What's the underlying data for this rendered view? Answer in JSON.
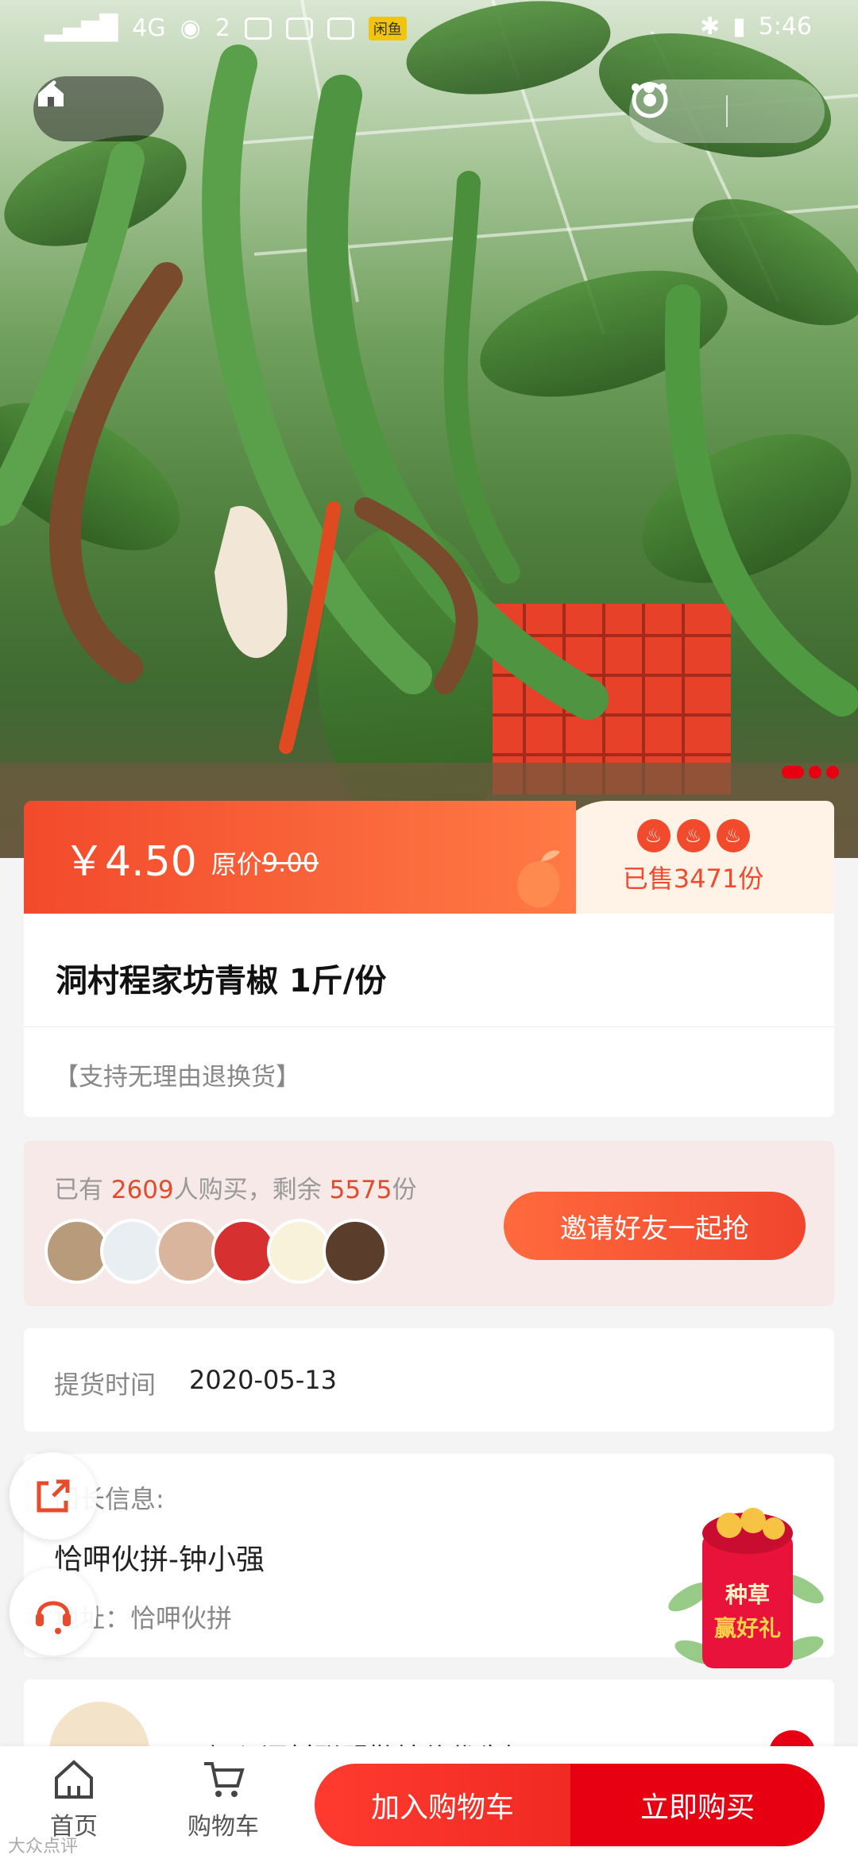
{
  "status_bar": {
    "network": "4G",
    "sim_slot": "2",
    "time": "5:46",
    "app_badge": "闲鱼"
  },
  "nav_capsule": {
    "back_icon": "chevron-left-icon",
    "home_icon": "home-icon",
    "more_icon": "more-dots-icon",
    "close_icon": "circle-target-icon"
  },
  "price": {
    "current": "￥4.50",
    "original_label": "原价",
    "original": "9.00",
    "sold": "已售3471份"
  },
  "product": {
    "title": "洞村程家坊青椒 1斤/份",
    "return_policy": "【支持无理由退换货】"
  },
  "group": {
    "prefix": "已有 ",
    "bought": "2609",
    "mid": "人购买，剩余 ",
    "remaining": "5575",
    "suffix": "份",
    "invite_label": "邀请好友一起抢",
    "avatar_colors": [
      "#b89b7a",
      "#e9eef2",
      "#d8b59c",
      "#d63031",
      "#f7f2d9",
      "#5a3d2b"
    ]
  },
  "pickup": {
    "label": "提货时间",
    "date": "2020-05-13"
  },
  "leader": {
    "label": "团长信息:",
    "name": "恰呷伙拼-钟小强",
    "address": "地址：恰呷伙拼"
  },
  "gift": {
    "line1": "种草",
    "line2": "赢好礼"
  },
  "next_item": {
    "text": "加入洞村联盟勤精价优先知"
  },
  "bottom_nav": {
    "home_label": "首页",
    "cart_label": "购物车",
    "add_cart_label": "加入购物车",
    "buy_now_label": "立即购买"
  },
  "watermark": "大众点评",
  "colors": {
    "accent": "#f24a2c",
    "buy": "#e60012"
  }
}
